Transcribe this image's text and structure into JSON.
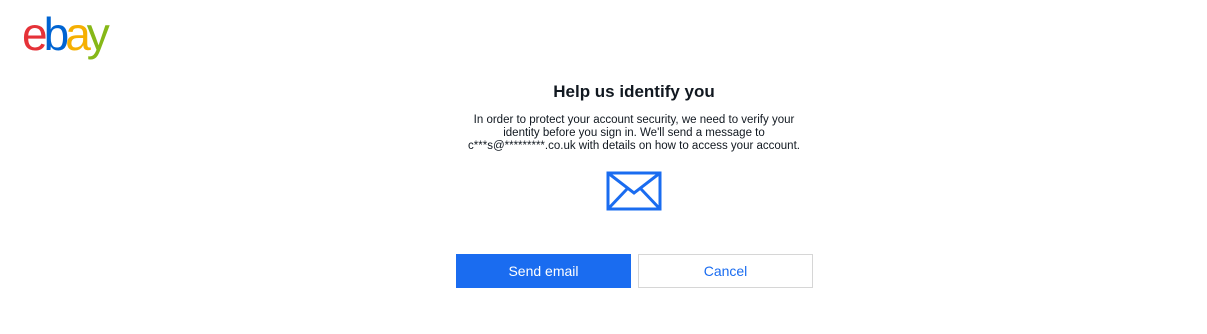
{
  "brand": {
    "logo_letters": [
      "e",
      "b",
      "a",
      "y"
    ],
    "colors": {
      "e": "#e53238",
      "b": "#0064d2",
      "a": "#f5af02",
      "y": "#86b817"
    }
  },
  "dialog": {
    "title": "Help us identify you",
    "message": "In order to protect your account security, we need to verify your identity before you sign in. We'll send a message to c***s@*********.co.uk with details on how to access your account.",
    "icon": "envelope-icon",
    "accent_color": "#1a6cf0"
  },
  "actions": {
    "send_label": "Send email",
    "cancel_label": "Cancel"
  }
}
